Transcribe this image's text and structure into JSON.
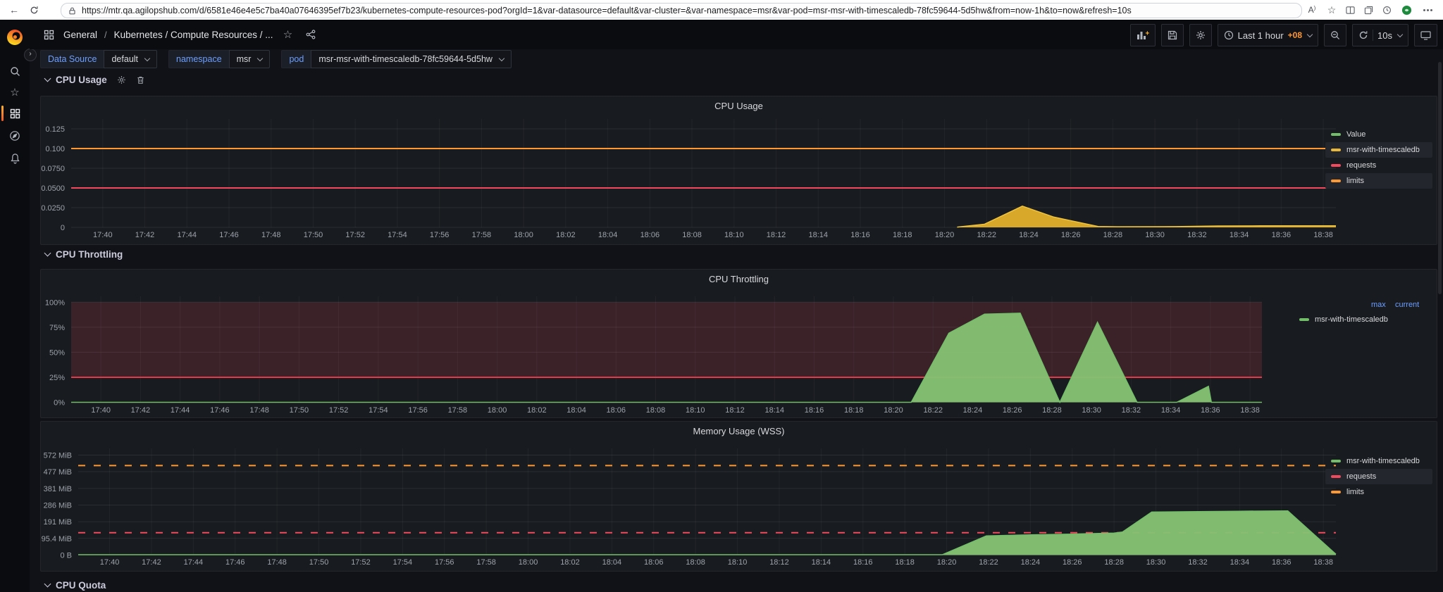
{
  "browser": {
    "url": "https://mtr.qa.agilopshub.com/d/6581e46e4e5c7ba40a07646395ef7b23/kubernetes-compute-resources-pod?orgId=1&var-datasource=default&var-cluster=&var-namespace=msr&var-pod=msr-msr-with-timescaledb-78fc59644-5d5hw&from=now-1h&to=now&refresh=10s"
  },
  "nav": {
    "breadcrumb_items": [
      "General",
      "Kubernetes / Compute Resources / ..."
    ]
  },
  "toolbar": {
    "time_range_label": "Last 1 hour",
    "utc_offset": "+08",
    "refresh_interval": "10s"
  },
  "variables": [
    {
      "label": "Data Source",
      "value": "default"
    },
    {
      "label": "namespace",
      "value": "msr"
    },
    {
      "label": "pod",
      "value": "msr-msr-with-timescaledb-78fc59644-5d5hw"
    }
  ],
  "sections": {
    "cpu_usage": "CPU Usage",
    "cpu_throttling": "CPU Throttling",
    "cpu_quota": "CPU Quota"
  },
  "colors": {
    "green": "#73BF69",
    "yellow": "#EAB839",
    "red": "#F2495C",
    "orange": "#FF9830",
    "link_blue": "#6E9FFF",
    "brand_orange": "#F05A28"
  },
  "chart_data": [
    {
      "id": "cpu-usage",
      "type": "area",
      "title": "CPU Usage",
      "x_ticks": [
        "17:40",
        "17:42",
        "17:44",
        "17:46",
        "17:48",
        "17:50",
        "17:52",
        "17:54",
        "17:56",
        "17:58",
        "18:00",
        "18:02",
        "18:04",
        "18:06",
        "18:08",
        "18:10",
        "18:12",
        "18:14",
        "18:16",
        "18:18",
        "18:20",
        "18:22",
        "18:24",
        "18:26",
        "18:28",
        "18:30",
        "18:32",
        "18:34",
        "18:36",
        "18:38"
      ],
      "x_range_minutes": [
        -1.5,
        58.6
      ],
      "y_ticks": [
        {
          "label": "0",
          "value": 0
        },
        {
          "label": "0.0250",
          "value": 0.025
        },
        {
          "label": "0.0500",
          "value": 0.05
        },
        {
          "label": "0.0750",
          "value": 0.075
        },
        {
          "label": "0.100",
          "value": 0.1
        },
        {
          "label": "0.125",
          "value": 0.125
        }
      ],
      "ylim": [
        0,
        0.1375
      ],
      "ref_lines": [
        {
          "name": "requests",
          "value": 0.05,
          "color": "#F2495C",
          "dash": false
        },
        {
          "name": "limits",
          "value": 0.1,
          "color": "#FF9830",
          "dash": false
        }
      ],
      "series": [
        {
          "name": "msr-with-timescaledb",
          "color": "#F0C33C",
          "fill": "#DFAE2B",
          "points": [
            [
              40.6,
              0.0004
            ],
            [
              41.9,
              0.004
            ],
            [
              43.7,
              0.027
            ],
            [
              45.2,
              0.013
            ],
            [
              47.3,
              0.0012
            ],
            [
              48.2,
              0.0008
            ],
            [
              51.0,
              0.001
            ],
            [
              53.0,
              0.0018
            ],
            [
              55.0,
              0.002
            ],
            [
              58.6,
              0.002
            ]
          ]
        }
      ],
      "legend": {
        "items": [
          {
            "label": "Value",
            "color": "#73BF69",
            "highlight": false
          },
          {
            "label": "msr-with-timescaledb",
            "color": "#EAB839",
            "highlight": true
          },
          {
            "label": "requests",
            "color": "#F2495C",
            "highlight": false
          },
          {
            "label": "limits",
            "color": "#FF9830",
            "highlight": true
          }
        ]
      }
    },
    {
      "id": "cpu-throttling",
      "type": "area",
      "title": "CPU Throttling",
      "x_ticks": [
        "17:40",
        "17:42",
        "17:44",
        "17:46",
        "17:48",
        "17:50",
        "17:52",
        "17:54",
        "17:56",
        "17:58",
        "18:00",
        "18:02",
        "18:04",
        "18:06",
        "18:08",
        "18:10",
        "18:12",
        "18:14",
        "18:16",
        "18:18",
        "18:20",
        "18:22",
        "18:24",
        "18:26",
        "18:28",
        "18:30",
        "18:32",
        "18:34",
        "18:36",
        "18:38"
      ],
      "x_range_minutes": [
        -1.5,
        58.6
      ],
      "y_ticks": [
        {
          "label": "0%",
          "value": 0
        },
        {
          "label": "25%",
          "value": 25
        },
        {
          "label": "50%",
          "value": 50
        },
        {
          "label": "75%",
          "value": 75
        },
        {
          "label": "100%",
          "value": 100
        }
      ],
      "ylim": [
        0,
        105.8
      ],
      "band": {
        "from": 25,
        "to": 100,
        "color": "rgba(242,73,92,0.16)"
      },
      "ref_lines": [
        {
          "name": "throttle-threshold",
          "value": 25,
          "color": "#E23A49",
          "dash": false
        }
      ],
      "series": [
        {
          "name": "msr-with-timescaledb",
          "color": "#73BF69",
          "fill": "#85C272",
          "points": [
            [
              -1.5,
              0
            ],
            [
              40.9,
              0
            ],
            [
              42.8,
              69
            ],
            [
              44.6,
              88
            ],
            [
              46.4,
              89
            ],
            [
              48.4,
              0
            ],
            [
              50.3,
              80
            ],
            [
              52.3,
              0
            ],
            [
              54.3,
              0
            ],
            [
              55.9,
              16
            ],
            [
              56.05,
              0
            ],
            [
              58.6,
              0
            ]
          ]
        }
      ],
      "legend": {
        "calcs": [
          "max",
          "current"
        ],
        "items": [
          {
            "label": "msr-with-timescaledb",
            "color": "#73BF69",
            "highlight": false
          }
        ]
      }
    },
    {
      "id": "memory-wss",
      "type": "area",
      "title": "Memory Usage (WSS)",
      "x_ticks": [
        "17:40",
        "17:42",
        "17:44",
        "17:46",
        "17:48",
        "17:50",
        "17:52",
        "17:54",
        "17:56",
        "17:58",
        "18:00",
        "18:02",
        "18:04",
        "18:06",
        "18:08",
        "18:10",
        "18:12",
        "18:14",
        "18:16",
        "18:18",
        "18:20",
        "18:22",
        "18:24",
        "18:26",
        "18:28",
        "18:30",
        "18:32",
        "18:34",
        "18:36",
        "18:38"
      ],
      "x_range_minutes": [
        -1.5,
        58.6
      ],
      "y_ticks": [
        {
          "label": "0 B",
          "value": 0
        },
        {
          "label": "95.4 MiB",
          "value": 95.4
        },
        {
          "label": "191 MiB",
          "value": 191
        },
        {
          "label": "286 MiB",
          "value": 286
        },
        {
          "label": "381 MiB",
          "value": 381
        },
        {
          "label": "477 MiB",
          "value": 477
        },
        {
          "label": "572 MiB",
          "value": 572
        }
      ],
      "ylim": [
        0,
        610
      ],
      "ref_lines": [
        {
          "name": "requests",
          "value": 128,
          "color": "#F2495C",
          "dash": true
        },
        {
          "name": "limits",
          "value": 512,
          "color": "#FF9830",
          "dash": true
        }
      ],
      "series": [
        {
          "name": "msr-with-timescaledb",
          "color": "#73BF69",
          "fill": "#85C272",
          "points": [
            [
              -1.5,
              2
            ],
            [
              39.8,
              2
            ],
            [
              41.9,
              110
            ],
            [
              44,
              116
            ],
            [
              46,
              120
            ],
            [
              48,
              126
            ],
            [
              48.4,
              132
            ],
            [
              49.8,
              246
            ],
            [
              52,
              249
            ],
            [
              54,
              251
            ],
            [
              56.3,
              253
            ],
            [
              58.6,
              5
            ]
          ]
        }
      ],
      "legend": {
        "items": [
          {
            "label": "msr-with-timescaledb",
            "color": "#73BF69",
            "highlight": false
          },
          {
            "label": "requests",
            "color": "#F2495C",
            "highlight": true
          },
          {
            "label": "limits",
            "color": "#FF9830",
            "highlight": false
          }
        ]
      }
    }
  ]
}
